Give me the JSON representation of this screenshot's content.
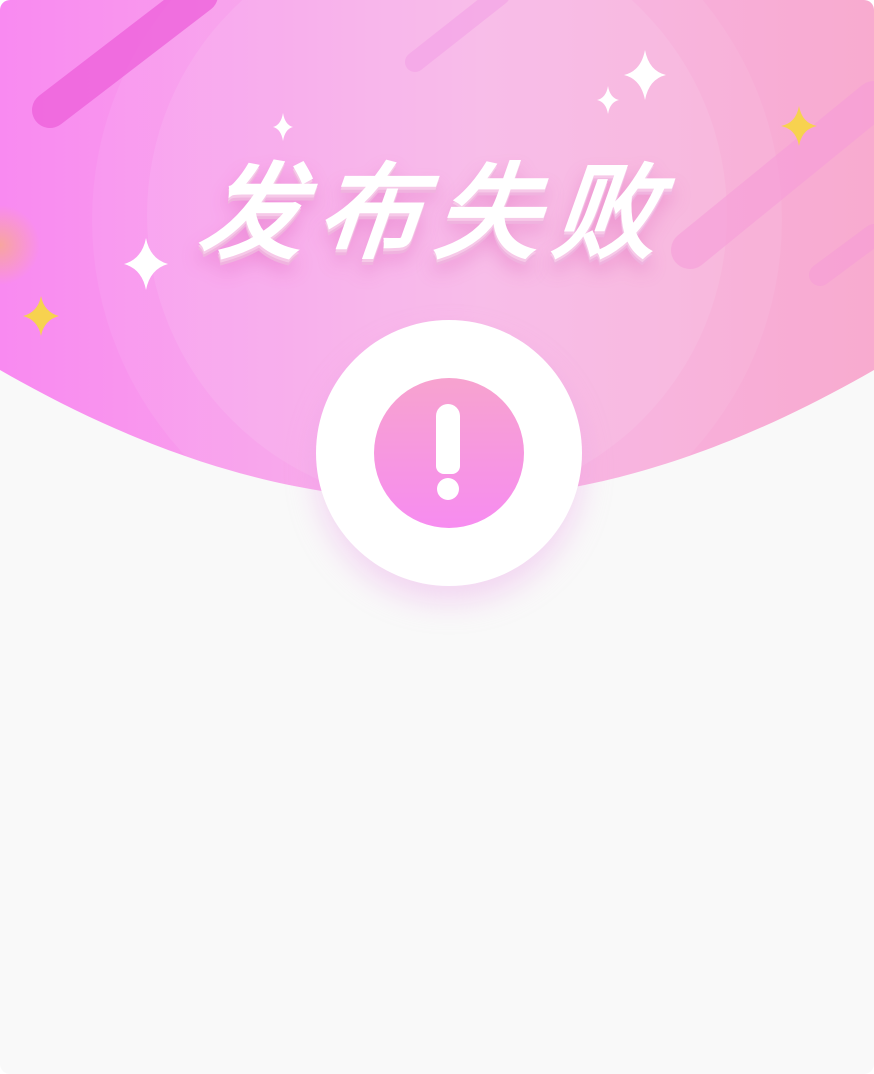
{
  "dialog": {
    "title": "发布失败",
    "status_icon": "exclamation-icon"
  },
  "colors": {
    "header_pink_left": "#f98af1",
    "header_pink_right": "#f9b4dc",
    "sparkle_white": "#ffffff",
    "sparkle_yellow": "#f7d24f",
    "alert_gradient_top": "#f7a3cf",
    "alert_gradient_bottom": "#f78cf0",
    "body_background": "#f9f9f9"
  }
}
